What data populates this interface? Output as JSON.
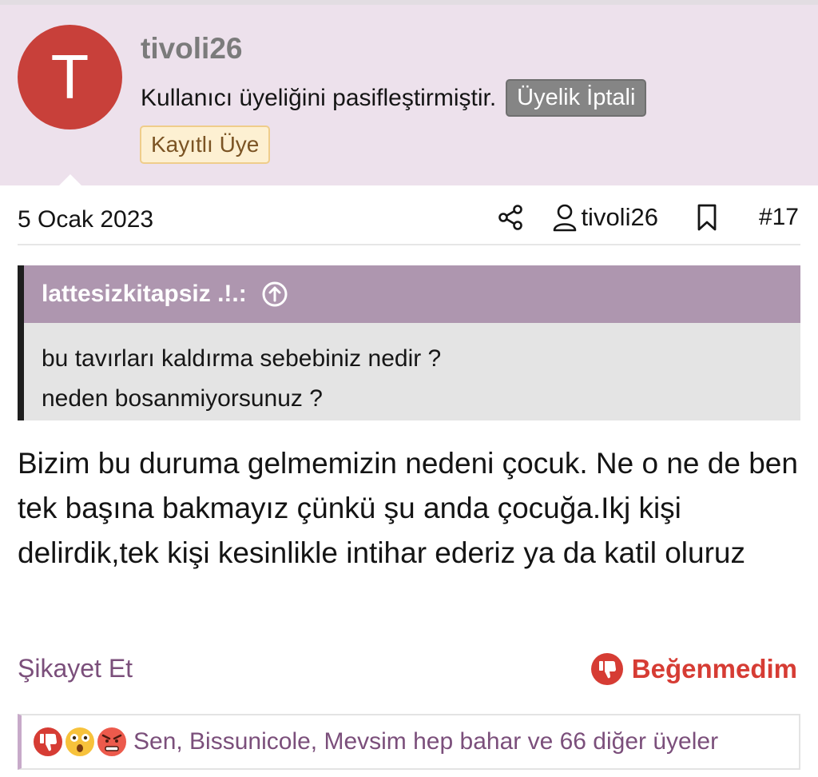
{
  "user": {
    "avatar_letter": "T",
    "username": "tivoli26",
    "status_text": "Kullanıcı üyeliğini pasifleştirmiştir.",
    "status_badge": "Üyelik İptali",
    "role_badge": "Kayıtlı Üye"
  },
  "meta": {
    "date": "5 Ocak 2023",
    "author": "tivoli26",
    "post_number": "#17"
  },
  "quote": {
    "author": "lattesizkitapsiz .!.:",
    "lines": [
      "bu tavırları kaldırma sebebiniz nedir ?",
      "neden bosanmiyorsunuz ?"
    ]
  },
  "post": {
    "body": "Bizim bu duruma gelmemizin nedeni çocuk. Ne o ne de ben tek başına bakmayız çünkü şu anda çocuğa.Ikj kişi delirdik,tek kişi kesinlikle intihar ederiz ya da katil oluruz"
  },
  "actions": {
    "report_label": "Şikayet Et",
    "dislike_label": "Beğenmedim"
  },
  "reactions": {
    "icons": [
      "thumbs-down-icon",
      "shocked-face-icon",
      "angry-face-icon"
    ],
    "summary": "Sen, Bissunicole, Mevsim hep bahar ve 66 diğer üyeler"
  },
  "colors": {
    "header_bg": "#ede1ec",
    "avatar_bg": "#c8403a",
    "quote_head_bg": "#ae96af",
    "accent_purple": "#7b4f7b",
    "dislike_red": "#d63c34"
  }
}
